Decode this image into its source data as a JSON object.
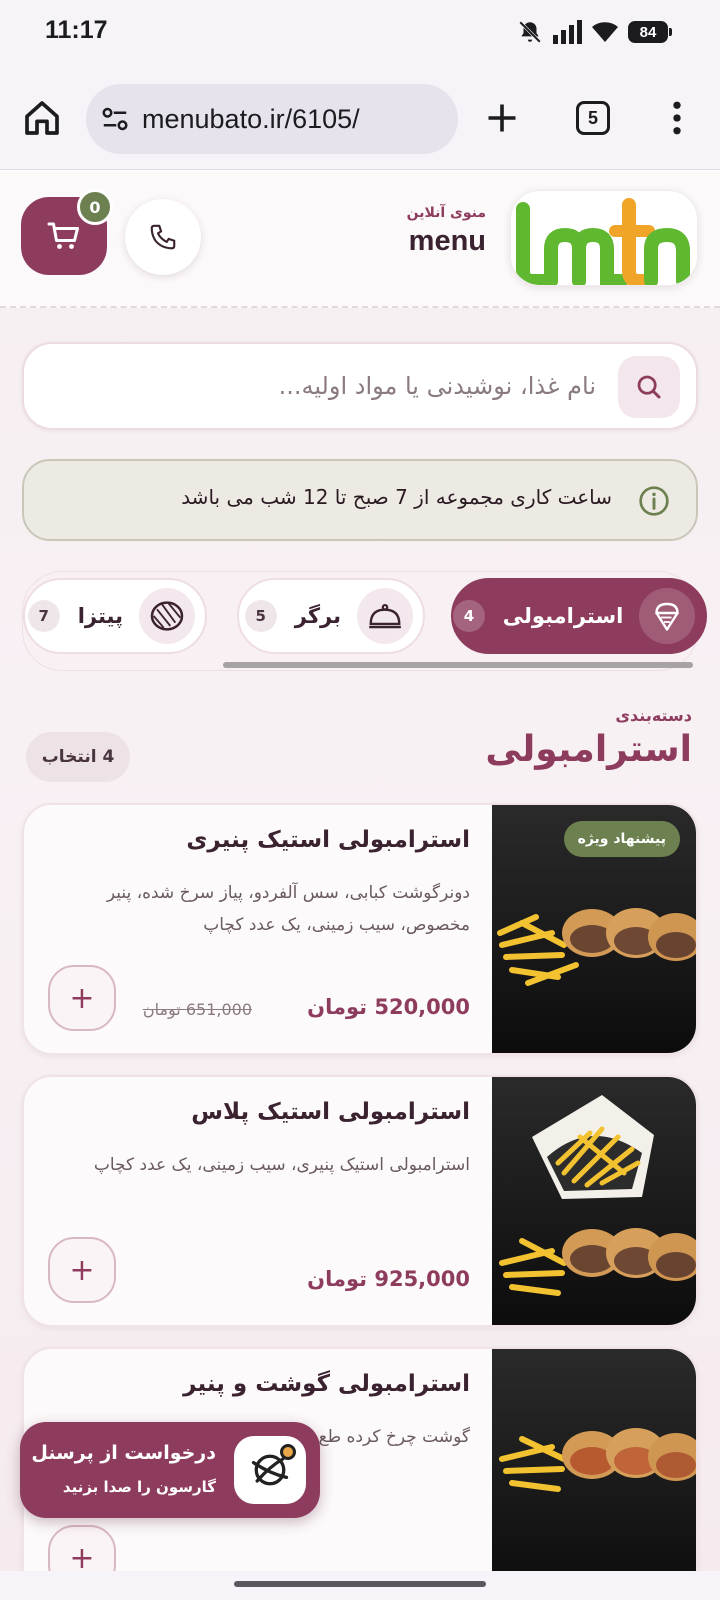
{
  "status_bar": {
    "time": "11:17",
    "battery": "84",
    "icons": [
      "bell-off-icon",
      "signal-icon",
      "wifi-icon",
      "battery-icon"
    ]
  },
  "browser": {
    "url": "menubato.ir/6105/",
    "tab_count": "5"
  },
  "header": {
    "brand_subtitle": "منوی آنلاین",
    "brand_title": "menu",
    "cart_count": "0"
  },
  "search": {
    "placeholder": "نام غذا، نوشیدنی یا مواد اولیه..."
  },
  "info": {
    "text": "ساعت کاری مجموعه از 7 صبح تا 12 شب می باشد"
  },
  "categories": [
    {
      "label": "استرامبولی",
      "count": "4",
      "icon": "ice-cream-icon",
      "active": true
    },
    {
      "label": "برگر",
      "count": "5",
      "icon": "cloche-icon",
      "active": false
    },
    {
      "label": "پیتزا",
      "count": "7",
      "icon": "pizza-icon",
      "active": false
    }
  ],
  "section": {
    "kicker": "دسته‌بندی",
    "title": "استرامبولی",
    "count_label": "4 انتخاب"
  },
  "products": [
    {
      "name": "استرامبولی استیک پنیری",
      "description": "دونرگوشت کبابی، سس آلفردو، پیاز سرخ شده، پنیر مخصوص، سیب زمینی، یک عدد کچاپ",
      "price": "520,000 تومان",
      "old_price": "651,000 تومان",
      "badge": "پیشنهاد ویژه"
    },
    {
      "name": "استرامبولی استیک پلاس",
      "description": "استرامبولی استیک پنیری، سیب زمینی، یک عدد کچاپ",
      "price": "925,000 تومان",
      "old_price": "",
      "badge": ""
    },
    {
      "name": "استرامبولی گوشت و پنیر",
      "description": "گوشت چرخ کرده طع... مخصوص، سیب زم...",
      "price": "",
      "old_price": "",
      "badge": ""
    }
  ],
  "staff_request": {
    "title": "درخواست از پرسنل",
    "subtitle": "گارسون را صدا بزنید"
  },
  "colors": {
    "primary": "#8e3c5e",
    "accent_green": "#6d8050",
    "background": "#f6eef1"
  }
}
